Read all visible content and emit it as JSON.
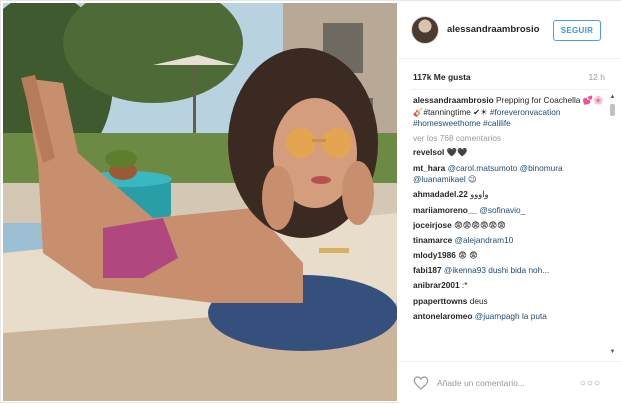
{
  "post": {
    "image_alt_icon": "photo-image",
    "username": "alessandraambrosio",
    "follow_label": "SEGUIR",
    "likes": "117k Me gusta",
    "time": "12 h",
    "caption_user": "alessandraambrosio",
    "caption_text": "Prepping for Coachella 💕🌸🎸#tanningtime ✔☀",
    "caption_tags": "#foreveronvacation #homesweethome #calilife",
    "view_all": "ver los 768 comentarios",
    "add_comment_placeholder": "Añade un comentario...",
    "more_label": "○○○"
  },
  "comments": [
    {
      "user": "revelsol",
      "text": "🖤🖤"
    },
    {
      "user": "mt_hara",
      "text": "@carol.matsumoto @binomura @luanamikael 😉"
    },
    {
      "user": "ahmadadel.22",
      "text": "واووو"
    },
    {
      "user": "mariiamoreno__",
      "text": "@sofinavio_"
    },
    {
      "user": "joceirjose",
      "text": "😨😨😨😨😨😨"
    },
    {
      "user": "tinamarce",
      "text": "@alejandram10"
    },
    {
      "user": "mlody1986",
      "text": "😨 😨"
    },
    {
      "user": "fabi187",
      "text": "@ikenna93 dushi bida noh..."
    },
    {
      "user": "anibrar2001",
      "text": ":*"
    },
    {
      "user": "ppaperttowns",
      "text": "deus"
    },
    {
      "user": "antonelaromeo",
      "text": "@juampagh la puta"
    }
  ],
  "colors": {
    "follow_blue": "#3897f0",
    "link_blue": "#1d4d7a",
    "muted": "#999999",
    "divider": "#efefef"
  }
}
